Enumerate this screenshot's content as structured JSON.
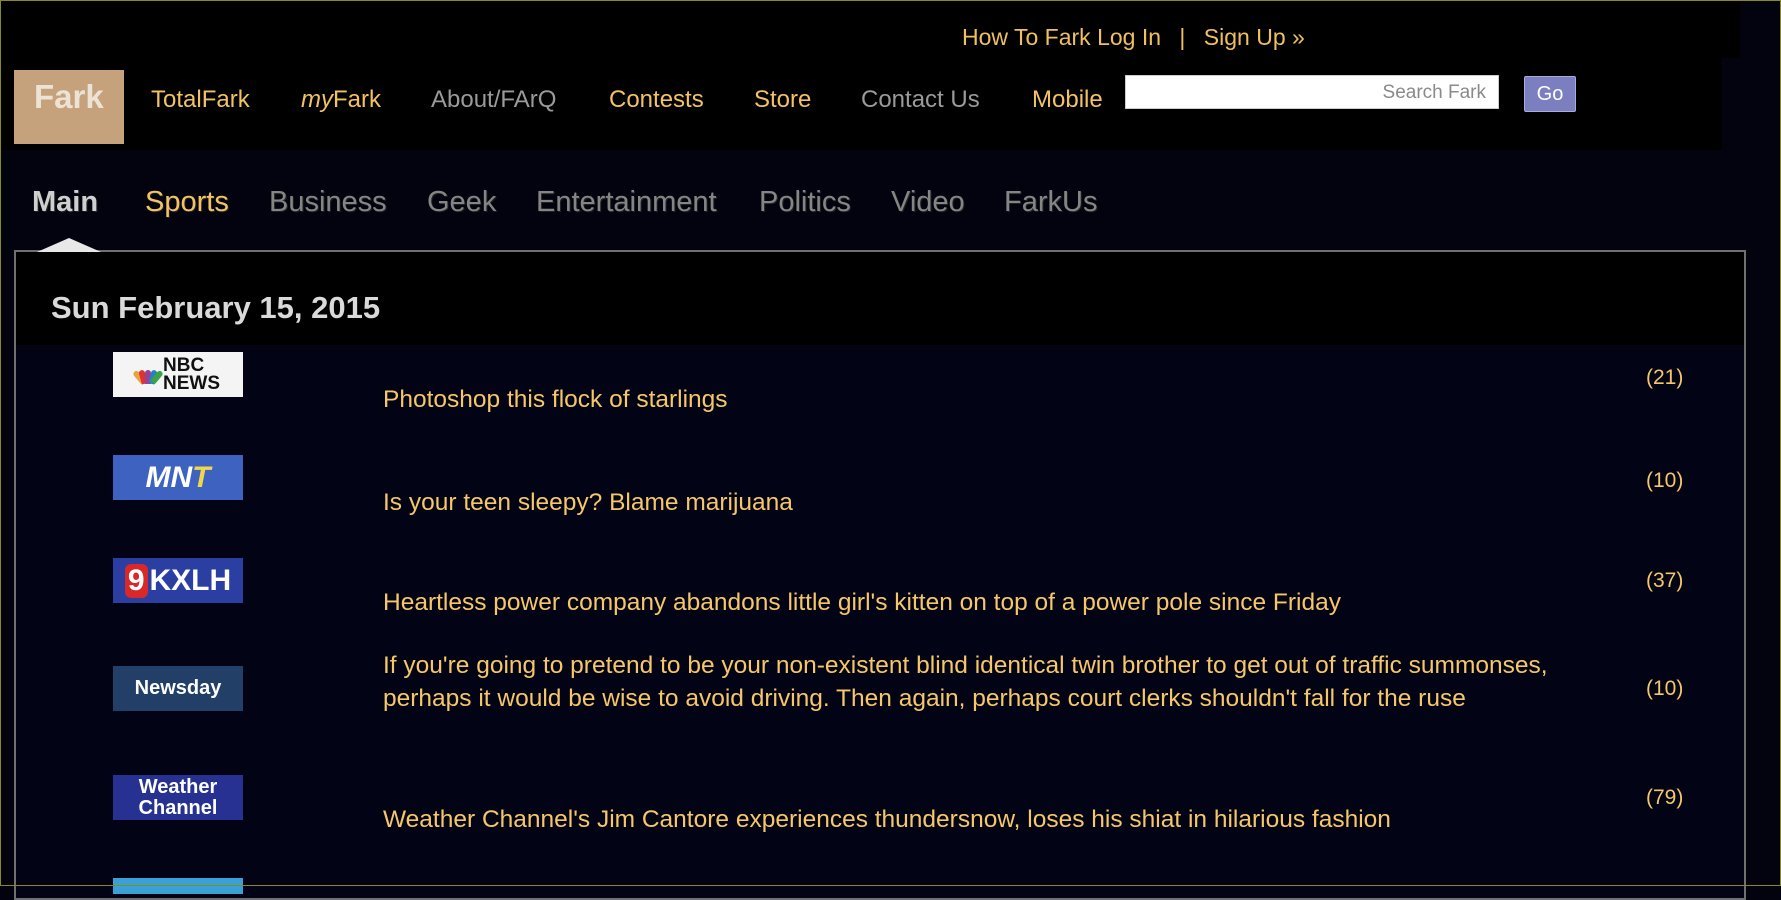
{
  "top_links": {
    "how_to": "How To Fark",
    "login": "Log In",
    "separator": "|",
    "signup": "Sign Up »"
  },
  "logo": {
    "text": "Fark"
  },
  "nav": {
    "totalfark": "TotalFark",
    "myfark_prefix": "my",
    "myfark_suffix": "Fark",
    "about": "About/FArQ",
    "contests": "Contests",
    "store": "Store",
    "contact": "Contact Us",
    "mobile": "Mobile"
  },
  "search": {
    "placeholder": "Search Fark",
    "go": "Go"
  },
  "tabs": [
    "Main",
    "Sports",
    "Business",
    "Geek",
    "Entertainment",
    "Politics",
    "Video",
    "FarkUs"
  ],
  "date": "Sun February 15, 2015",
  "logos": {
    "nbc": [
      "NBC",
      "NEWS"
    ],
    "mnt_a": "MN",
    "mnt_b": "T",
    "kxlh_nine": "9",
    "kxlh": "KXLH",
    "newsday": "Newsday",
    "weather": [
      "Weather",
      "Channel"
    ]
  },
  "stories": [
    {
      "headline": "Photoshop this flock of starlings",
      "count": "(21)"
    },
    {
      "headline": "Is your teen sleepy? Blame marijuana",
      "count": "(10)"
    },
    {
      "headline": "Heartless power company abandons little girl's kitten on top of a power pole since Friday",
      "count": "(37)"
    },
    {
      "headline": "If you're going to pretend to be your non-existent blind identical twin brother to get out of traffic summonses, perhaps it would be wise to avoid driving. Then again, perhaps court clerks shouldn't fall for the ruse",
      "count": "(10)"
    },
    {
      "headline": "Weather Channel's Jim Cantore experiences thundersnow, loses his shiat in hilarious fashion",
      "count": "(79)"
    }
  ]
}
